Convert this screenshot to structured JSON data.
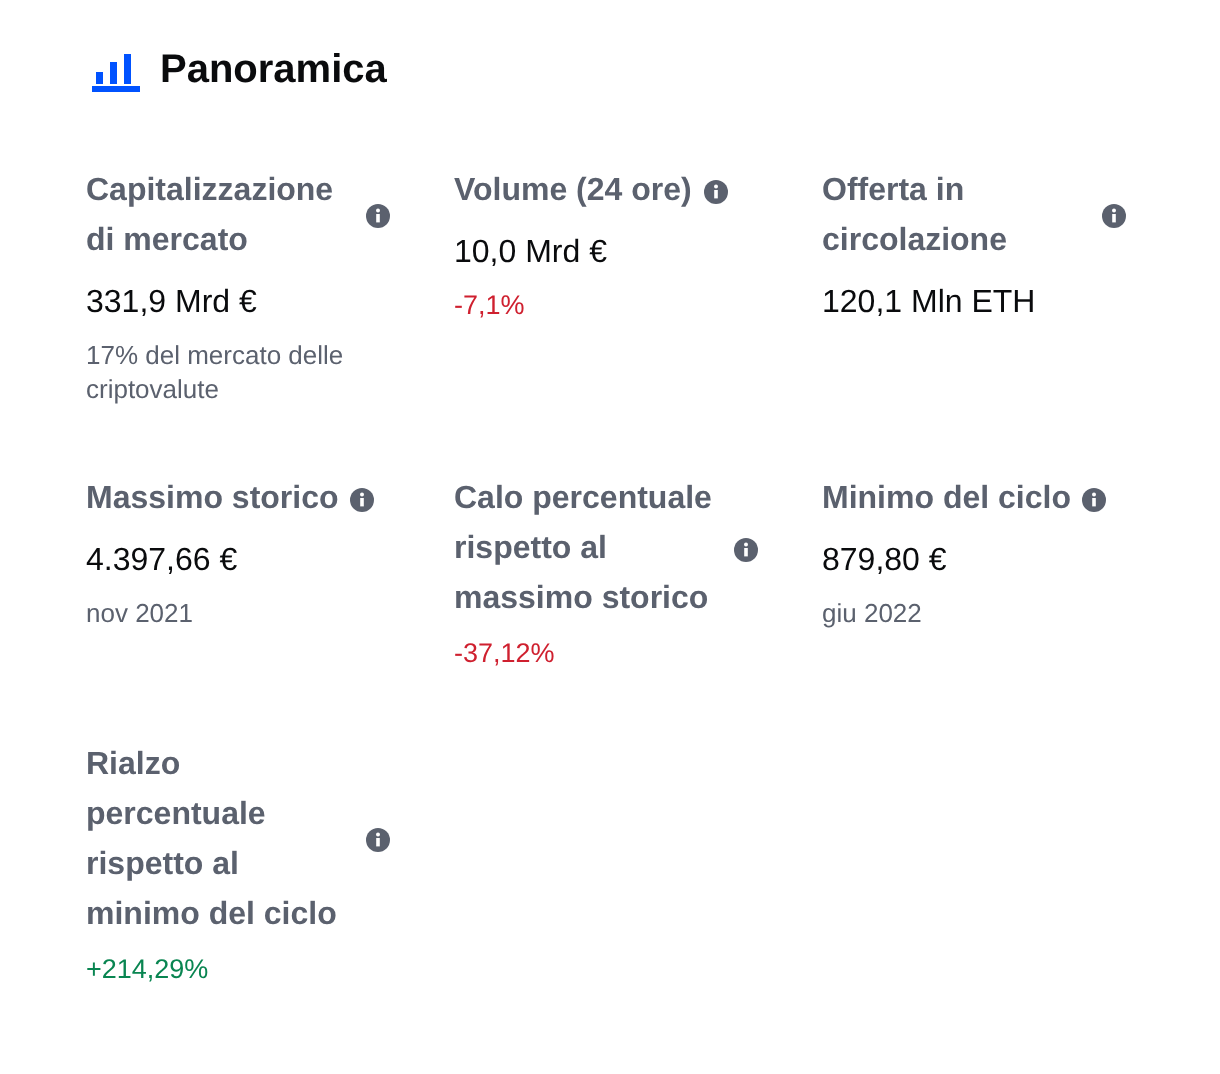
{
  "header": {
    "title": "Panoramica"
  },
  "stats": [
    {
      "label": "Capitalizzazione di mercato",
      "value": "331,9 Mrd €",
      "note": "17% del mercato delle criptovalute"
    },
    {
      "label": "Volume (24 ore)",
      "value": "10,0 Mrd €",
      "change": {
        "text": "-7,1%",
        "color": "#cf202f"
      }
    },
    {
      "label": "Offerta in circolazione",
      "value": "120,1 Mln ETH"
    },
    {
      "label": "Massimo storico",
      "value": "4.397,66 €",
      "note": "nov 2021"
    },
    {
      "label": "Calo percentuale rispetto al massimo storico",
      "change": {
        "text": "-37,12%",
        "color": "#cf202f"
      }
    },
    {
      "label": "Minimo del ciclo",
      "value": "879,80 €",
      "note": "giu 2022"
    },
    {
      "label": "Rialzo percentuale rispetto al minimo del ciclo",
      "change": {
        "text": "+214,29%",
        "color": "#098551"
      }
    }
  ]
}
